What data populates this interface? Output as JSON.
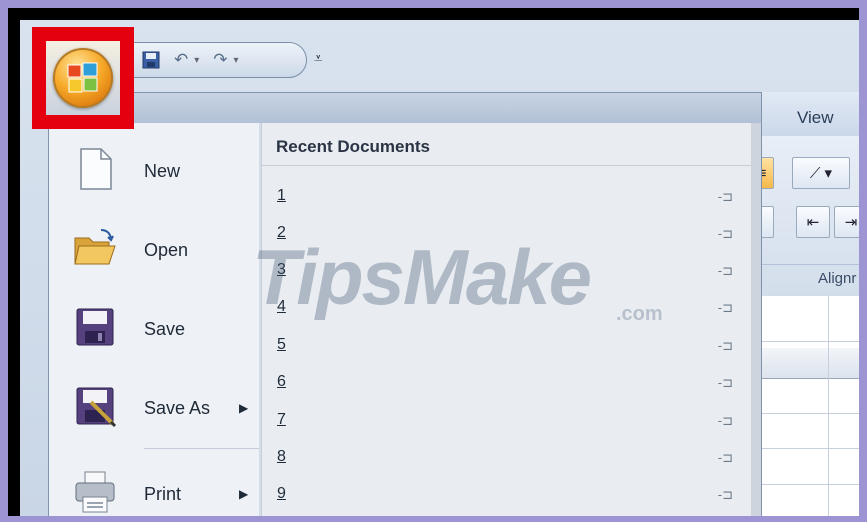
{
  "qat": {
    "save_icon": "save-icon",
    "undo_icon": "undo-icon",
    "redo_icon": "redo-icon",
    "customize_icon": "customize-qat-icon"
  },
  "ribbon": {
    "tab_view": "View",
    "group_label": "Alignr"
  },
  "menu": {
    "items": [
      {
        "label": "New",
        "icon": "new-document-icon"
      },
      {
        "label": "Open",
        "icon": "open-folder-icon"
      },
      {
        "label": "Save",
        "icon": "save-icon"
      },
      {
        "label": "Save As",
        "icon": "save-as-icon"
      },
      {
        "label": "Print",
        "icon": "printer-icon"
      }
    ],
    "recent_title": "Recent Documents",
    "recent": [
      "1",
      "2",
      "3",
      "4",
      "5",
      "6",
      "7",
      "8",
      "9"
    ]
  },
  "watermark": {
    "main": "TipsMake",
    "sub": ".com"
  },
  "colors": {
    "highlight": "#e4000f",
    "background": "#9d95d3"
  }
}
